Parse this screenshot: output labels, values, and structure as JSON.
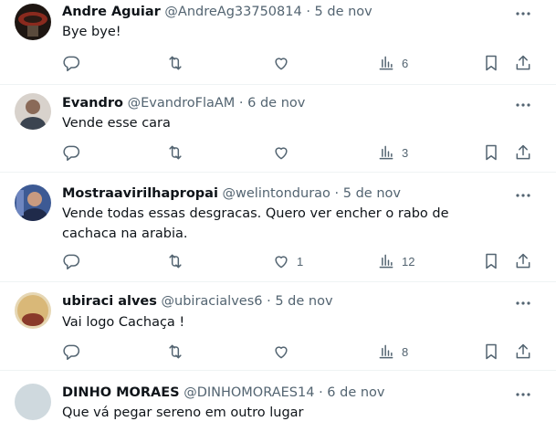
{
  "tweets": [
    {
      "name": "Andre Aguiar",
      "handle": "@AndreAg33750814",
      "separator": "·",
      "date": "5 de nov",
      "text": "Bye bye!",
      "counts": {
        "reply": "",
        "retweet": "",
        "like": "",
        "views": "6"
      },
      "avatar_color": "#3a2a22"
    },
    {
      "name": "Evandro",
      "handle": "@EvandroFlaAM",
      "separator": "·",
      "date": "6 de nov",
      "text": "Vende esse cara",
      "counts": {
        "reply": "",
        "retweet": "",
        "like": "",
        "views": "3"
      },
      "avatar_color": "#6b7380"
    },
    {
      "name": "Mostraavirilhapropai",
      "handle": "@welintondurao",
      "separator": "·",
      "date": "5 de nov",
      "text": "Vende todas essas desgracas. Quero ver encher o rabo de cachaca na arabia.",
      "counts": {
        "reply": "",
        "retweet": "",
        "like": "1",
        "views": "12"
      },
      "avatar_color": "#4a5a8a"
    },
    {
      "name": "ubiraci alves",
      "handle": "@ubiracialves6",
      "separator": "·",
      "date": "5 de nov",
      "text": "Vai logo Cachaça !",
      "counts": {
        "reply": "",
        "retweet": "",
        "like": "",
        "views": "8"
      },
      "avatar_color": "#c9a66b"
    },
    {
      "name": "DINHO MORAES",
      "handle": "@DINHOMORAES14",
      "separator": "·",
      "date": "6 de nov",
      "text": "Que vá pegar sereno em outro lugar",
      "counts": {
        "reply": "",
        "retweet": "",
        "like": "",
        "views": ""
      },
      "avatar_color": "#cfd9de"
    }
  ],
  "icons": {
    "reply": "reply-icon",
    "retweet": "retweet-icon",
    "like": "like-icon",
    "views": "views-icon",
    "bookmark": "bookmark-icon",
    "share": "share-icon",
    "more": "more-icon"
  },
  "colors": {
    "text": "#0f1419",
    "muted": "#536471",
    "divider": "#eff3f4"
  }
}
